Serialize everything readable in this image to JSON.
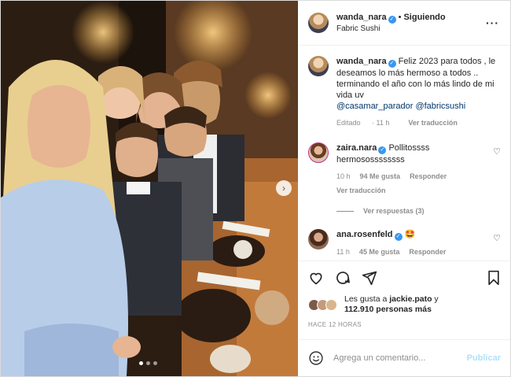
{
  "post": {
    "author": "wanda_nara",
    "follow_status": "Siguiendo",
    "location": "Fabric Sushi",
    "more_icon": "more-options-icon"
  },
  "caption": {
    "author": "wanda_nara",
    "text": "Feliz 2023 para todos , le deseamos lo más hermoso a todos .. terminando el año con lo más lindo de mi vida uv",
    "mentions": [
      "@casamar_parador",
      "@fabricsushi"
    ],
    "edited": "Editado",
    "age": "11 h",
    "see_translation": "Ver traducción"
  },
  "comments": [
    {
      "author": "zaira.nara",
      "verified": true,
      "text": "Pollitossss hermosossssssss",
      "age": "10 h",
      "likes": "94 Me gusta",
      "reply": "Responder",
      "see_translation": "Ver traducción",
      "view_replies": "Ver respuestas (3)"
    },
    {
      "author": "ana.rosenfeld",
      "verified": true,
      "text": "🤩",
      "age": "11 h",
      "likes": "45 Me gusta",
      "reply": "Responder"
    }
  ],
  "likes": {
    "prefix": "Les gusta a",
    "user": "jackie.pato",
    "connector": "y",
    "count": "112.910 personas más"
  },
  "timestamp": "HACE 12 HORAS",
  "add_comment": {
    "placeholder": "Agrega un comentario...",
    "publish": "Publicar"
  },
  "colors": {
    "link": "#00376b",
    "verified": "#3897f0",
    "publish_disabled": "#b2dffc",
    "muted": "#8e8e8e"
  }
}
